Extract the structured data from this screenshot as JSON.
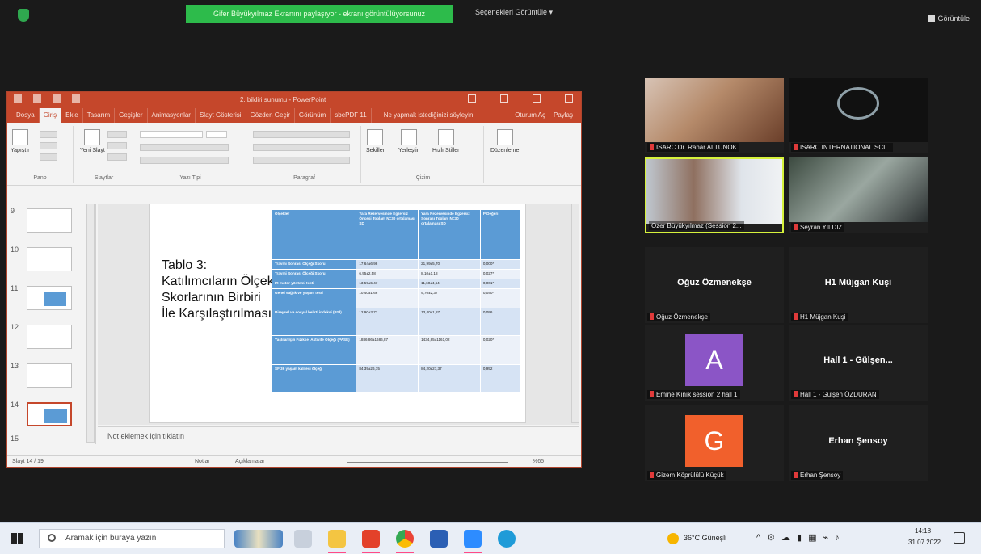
{
  "zoom": {
    "share_banner": "Gifer Büyükyılmaz Ekranını paylaşıyor - ekranı görüntülüyorsunuz",
    "view_options": "Seçenekleri Görüntüle ▾",
    "view_mode": "Görüntüle",
    "participants": [
      {
        "name": "ISARC Dr. Rahar ALTUNOK",
        "muted": true,
        "type": "video"
      },
      {
        "name": "ISARC INTERNATIONAL SCI...",
        "muted": true,
        "type": "logo"
      },
      {
        "name": "Ozer Büyükyılmaz (Session 2...",
        "muted": false,
        "type": "video",
        "speaking": true
      },
      {
        "name": "Seyran YILDIZ",
        "muted": true,
        "type": "video"
      },
      {
        "name": "Oğuz Özmenekşe",
        "muted": true,
        "type": "name",
        "display": "Oğuz Özmenekşe"
      },
      {
        "name": "H1 Müjgan Kuşi",
        "muted": true,
        "type": "name",
        "display": "H1 Müjgan Kuşi"
      },
      {
        "name": "Emine Kınık session 2 hall 1",
        "muted": true,
        "type": "avatar",
        "letter": "A",
        "color": "#8b55c6"
      },
      {
        "name": "Hall 1 - Gülşen ÖZDURAN",
        "muted": true,
        "type": "name",
        "display": "Hall 1 - Gülşen..."
      },
      {
        "name": "Gizem Köprülülü Küçük",
        "muted": true,
        "type": "avatar",
        "letter": "G",
        "color": "#f1602c"
      },
      {
        "name": "Erhan Şensoy",
        "muted": true,
        "type": "name",
        "display": "Erhan Şensoy"
      }
    ]
  },
  "ppt": {
    "title": "2. bildiri sunumu - PowerPoint",
    "tabs": [
      "Dosya",
      "Giriş",
      "Ekle",
      "Tasarım",
      "Geçişler",
      "Animasyonlar",
      "Slayt Gösterisi",
      "Gözden Geçir",
      "Görünüm",
      "sbePDF 11",
      "Ne yapmak istediğinizi söyleyin",
      "Oturum Aç",
      "Paylaş"
    ],
    "ribbon": {
      "paste": "Yapıştır",
      "new_slide": "Yeni Slayt",
      "groups": [
        "Pano",
        "Slaytlar",
        "Yazı Tipi",
        "Paragraf",
        "Çizim",
        "Düzenleme"
      ],
      "shapes": "Şekiller",
      "arrange": "Yerleştir",
      "styles": "Hızlı Stiller",
      "edit": "Düzenleme"
    },
    "thumbnails": [
      "9",
      "10",
      "11",
      "12",
      "13",
      "14",
      "15"
    ],
    "selected_slide": "14",
    "slide": {
      "title": "Tablo 3: Katılımcıların Ölçek Skorlarının Birbiri İle Karşılaştırılması",
      "table": {
        "headers": [
          "Ölçekler",
          "Yara Rezervesinde Egzersiz Öncesi Toplam N=30 ortalaması SD",
          "Yara Rezervesinde Egzersiz Sonrası Toplam N=30 ortalaması SD",
          "P Değeri"
        ],
        "rows": [
          [
            "Travmi Sonrası Ölçeği Skoru",
            "17,64±6,98",
            "21,99±5,70",
            "0,000*"
          ],
          [
            "Travmi Sonrası Ölçeği Skoru",
            "6,95±2,58",
            "8,10±1,18",
            "0,027*"
          ],
          [
            "IR motor yöntemi testi",
            "13,59±5,47",
            "11,60±4,64",
            "0,001*"
          ],
          [
            "Genel sağlık ve yaşam testi",
            "10,40±1,66",
            "9,70±2,37",
            "0,040*"
          ],
          [
            "Bireysel ve sosyal belirti indeksi (BSİ)",
            "12,90±3,71",
            "13,40±1,87",
            "0,096"
          ],
          [
            "Yaşlılar İçin Fiziksel Aktivite Ölçeği (PASE)",
            "1886,86±1686,87",
            "1434,85±1161,02",
            "0,020*"
          ],
          [
            "SF 36 yaşam kalitesi ölçeği",
            "84,39±26,75",
            "84,20±27,37",
            "0,952"
          ]
        ]
      }
    },
    "notes_placeholder": "Not eklemek için tıklatın",
    "status": {
      "slide_count": "Slayt 14 / 19",
      "notes": "Notlar",
      "comments": "Açıklamalar",
      "zoom": "%65"
    }
  },
  "taskbar": {
    "search_placeholder": "Aramak için buraya yazın",
    "weather": "36°C Güneşli",
    "time": "14:18",
    "date": "31.07.2022"
  }
}
